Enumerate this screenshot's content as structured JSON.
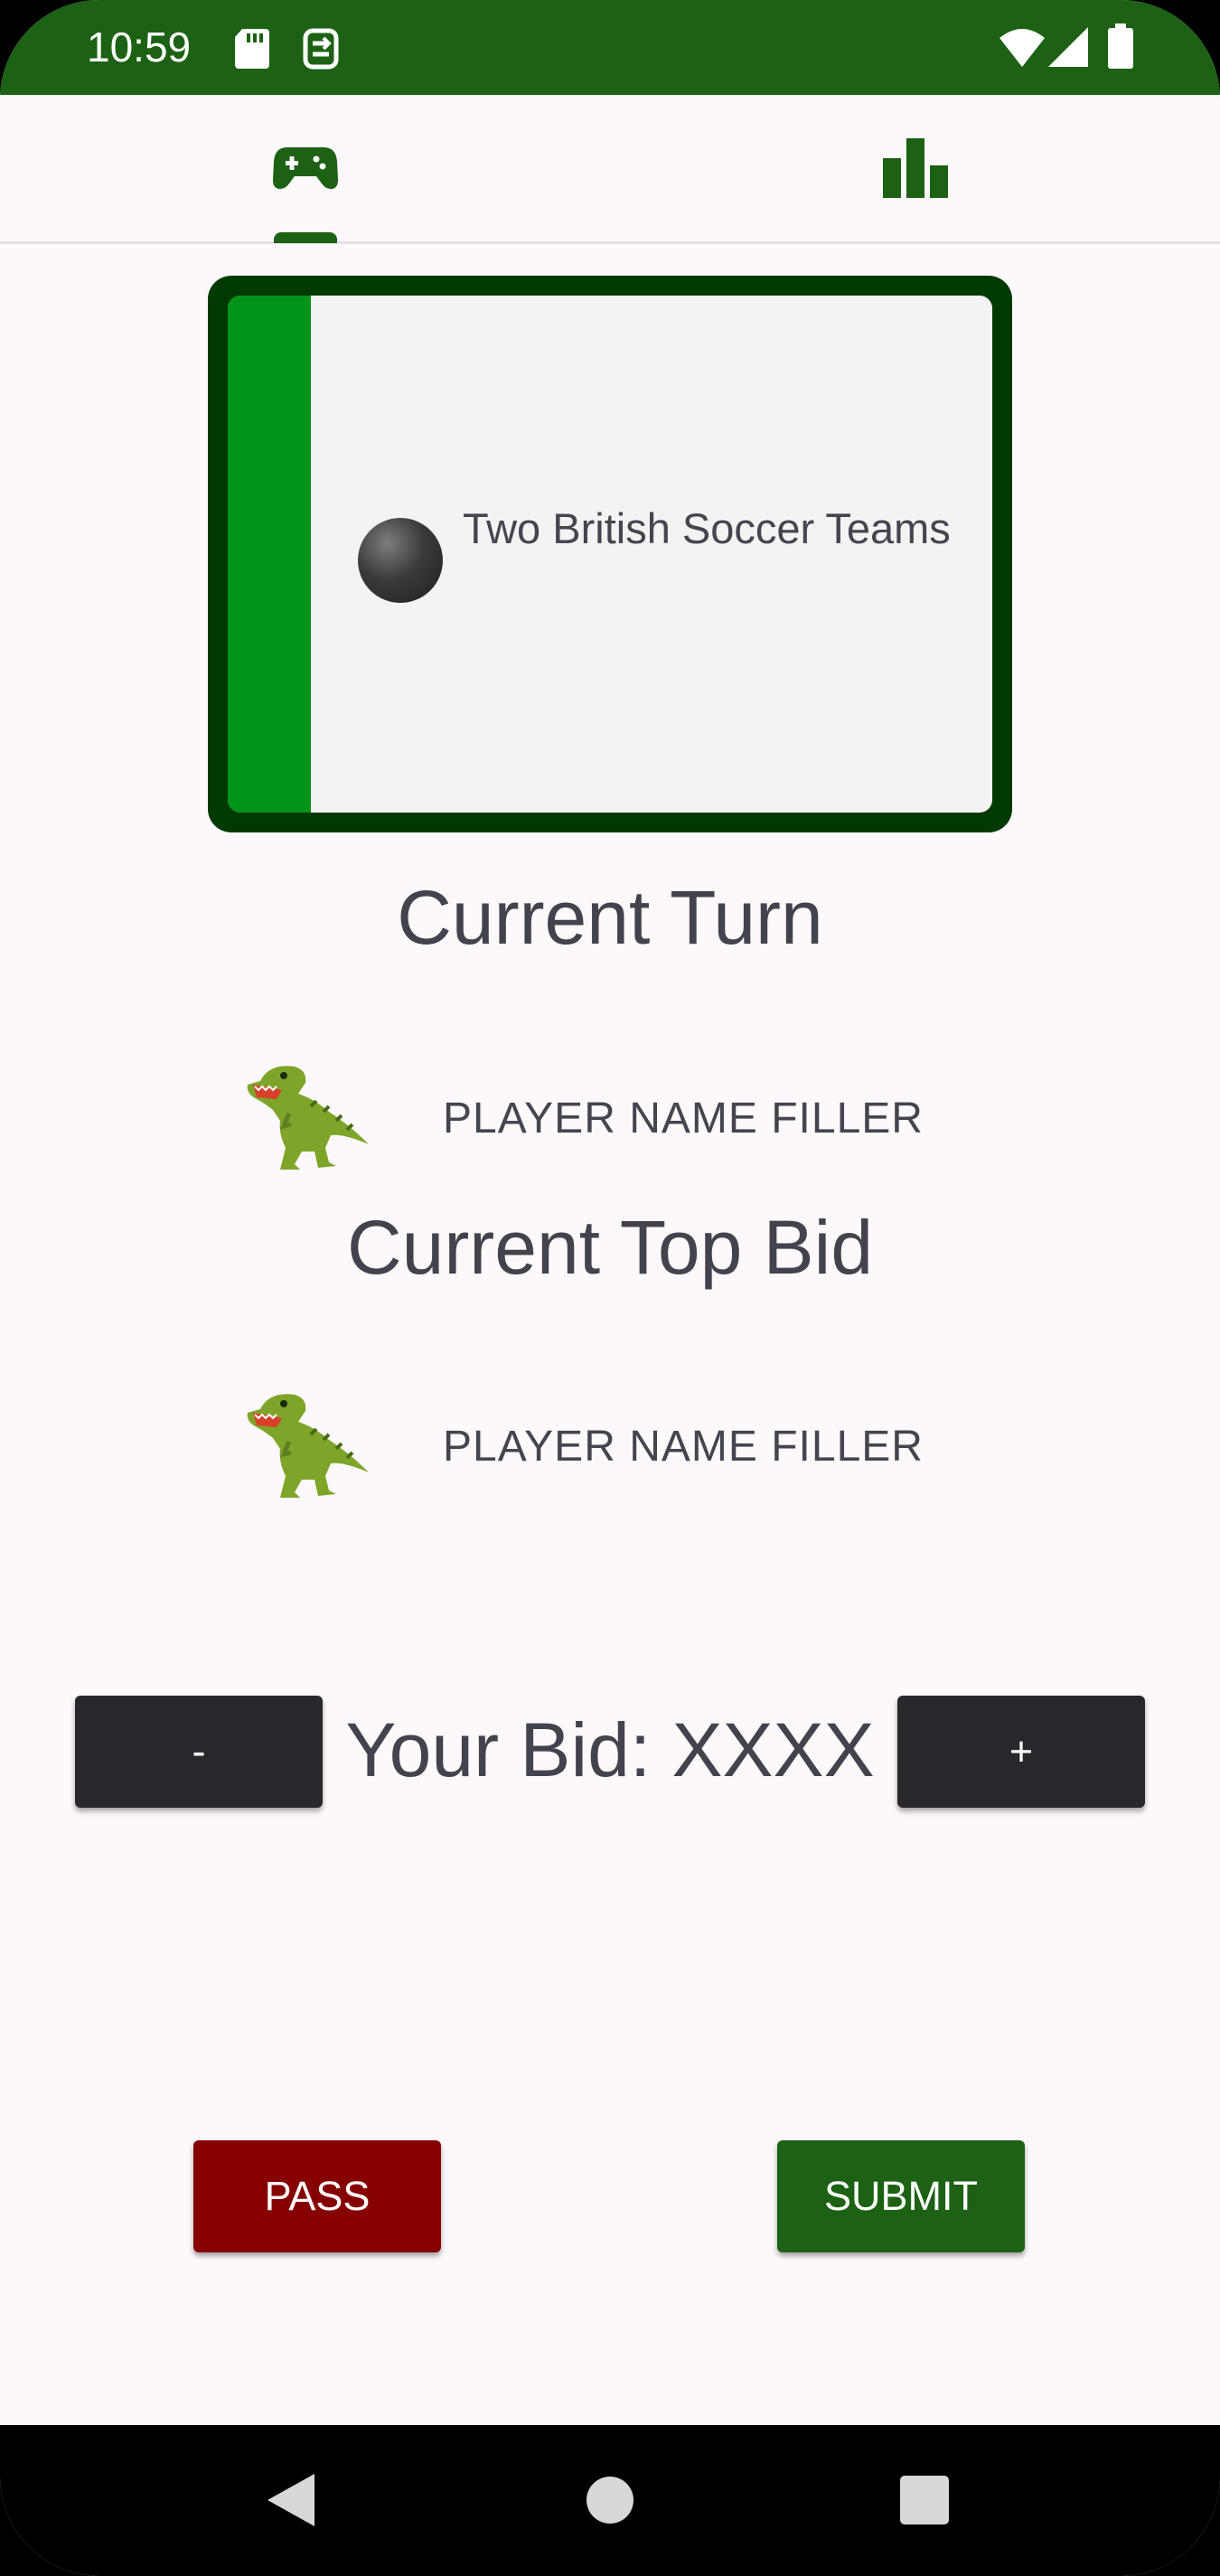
{
  "status_bar": {
    "time": "10:59",
    "icons": [
      "sd-card-icon",
      "sync-icon",
      "wifi-icon",
      "signal-icon",
      "battery-icon"
    ],
    "background": "#1c6114"
  },
  "tabs": [
    {
      "icon": "gamepad-icon",
      "selected": true
    },
    {
      "icon": "bar-chart-icon",
      "selected": false
    }
  ],
  "card": {
    "icon": "soccer-ball-icon",
    "text": "Two British Soccer Teams",
    "border_color": "#003a00",
    "stripe_color": "#009418"
  },
  "current_turn": {
    "heading": "Current Turn",
    "avatar": "dinosaur-icon",
    "player_name": "PLAYER NAME FILLER"
  },
  "current_top_bid": {
    "heading": "Current Top Bid",
    "avatar": "dinosaur-icon",
    "player_name": "PLAYER NAME FILLER"
  },
  "bid": {
    "decrement_label": "-",
    "label": "Your Bid: XXXX",
    "increment_label": "+"
  },
  "actions": {
    "pass_label": "PASS",
    "pass_color": "#860000",
    "submit_label": "SUBMIT",
    "submit_color": "#1c6114"
  },
  "nav_bar": {
    "icons": [
      "back-icon",
      "home-icon",
      "recents-icon"
    ]
  }
}
